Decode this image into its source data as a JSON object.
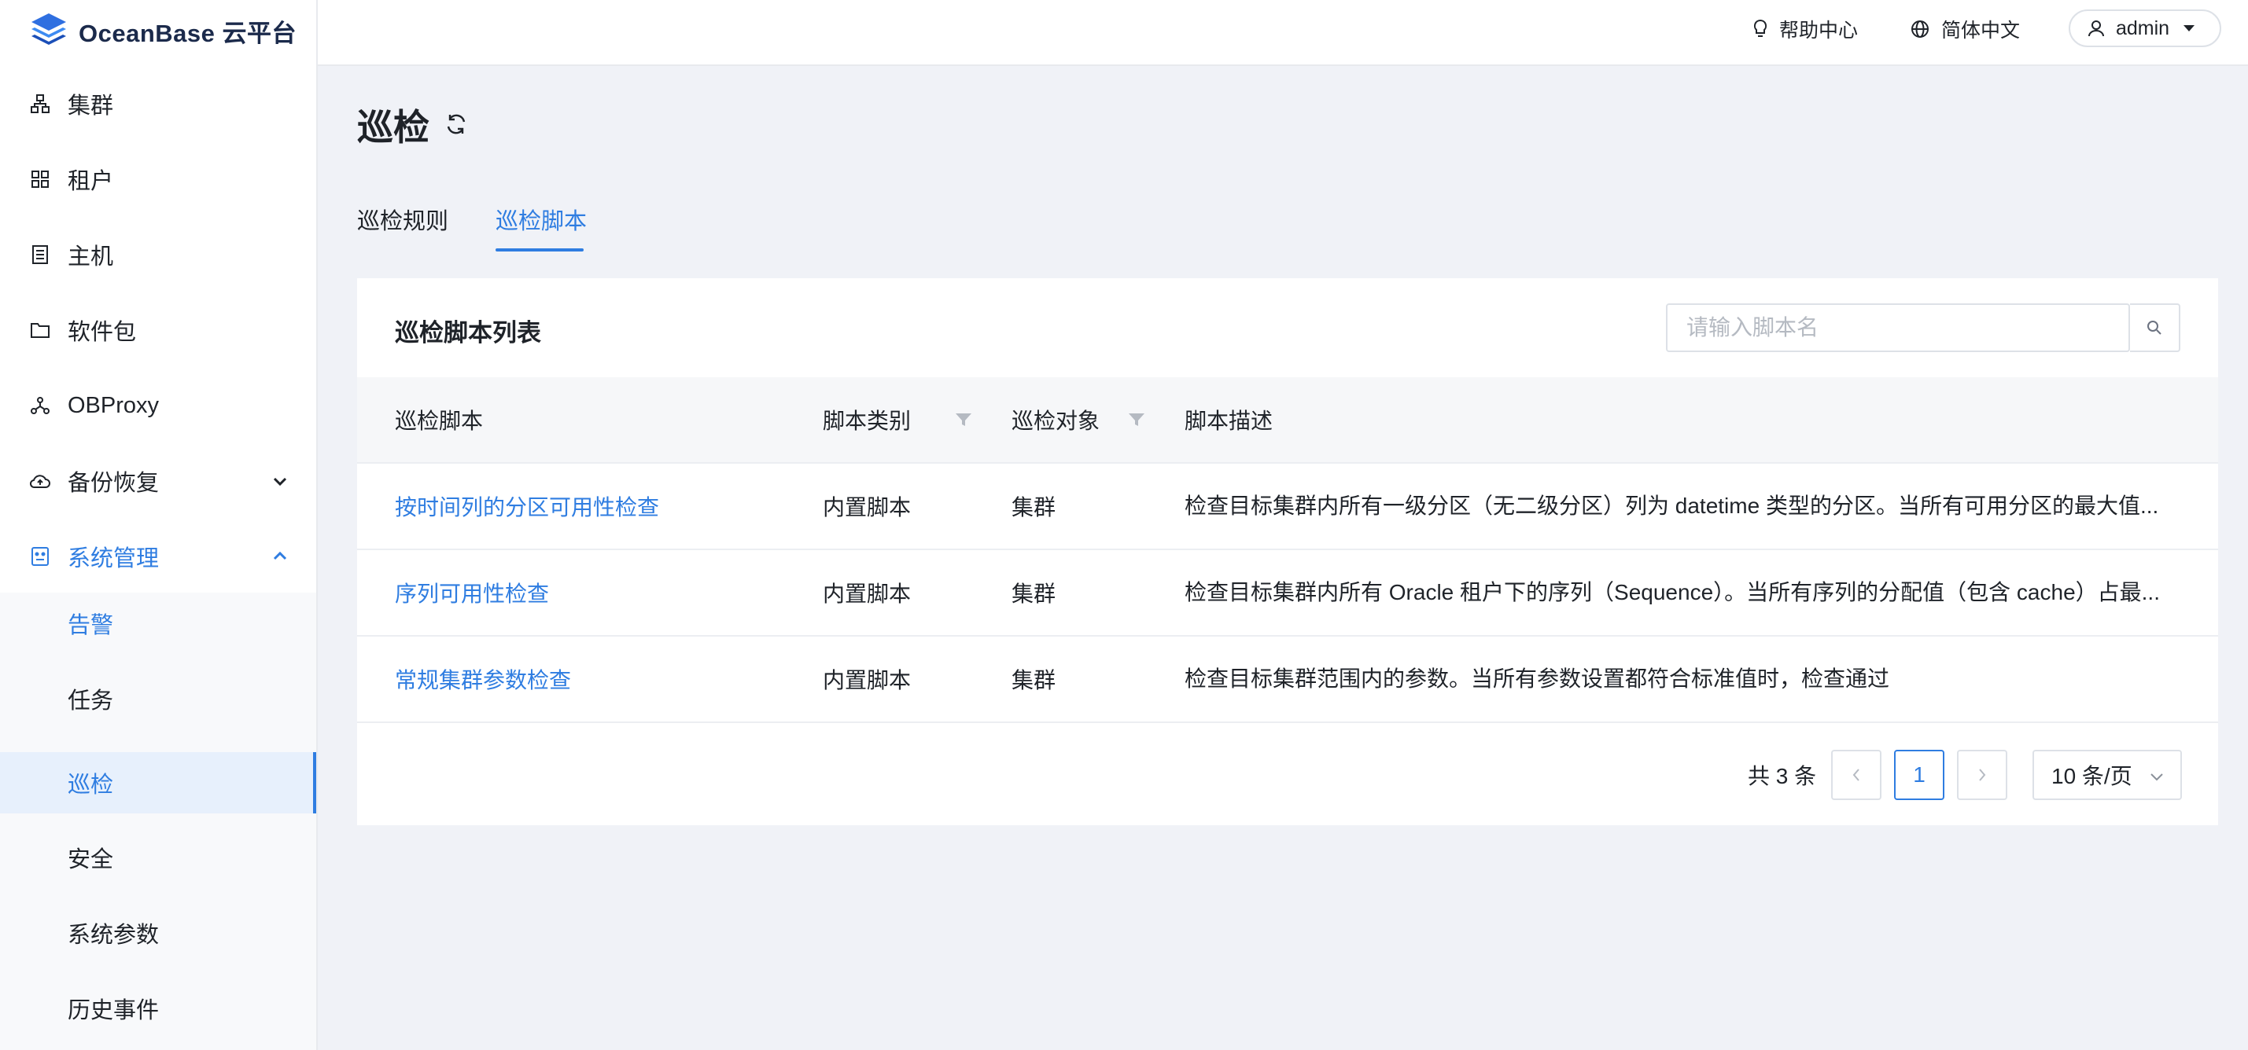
{
  "app": {
    "name": "OceanBase 云平台"
  },
  "header": {
    "help_label": "帮助中心",
    "lang_label": "简体中文",
    "user_label": "admin"
  },
  "sidebar": {
    "items": [
      {
        "label": "集群",
        "icon": "cluster-icon"
      },
      {
        "label": "租户",
        "icon": "tenant-grid-icon"
      },
      {
        "label": "主机",
        "icon": "host-icon"
      },
      {
        "label": "软件包",
        "icon": "folder-icon"
      },
      {
        "label": "OBProxy",
        "icon": "proxy-icon"
      },
      {
        "label": "备份恢复",
        "icon": "cloud-backup-icon"
      },
      {
        "label": "系统管理",
        "icon": "system-icon"
      }
    ],
    "sub_items": [
      {
        "label": "告警"
      },
      {
        "label": "任务"
      },
      {
        "label": "巡检"
      },
      {
        "label": "安全"
      },
      {
        "label": "系统参数"
      },
      {
        "label": "历史事件"
      }
    ]
  },
  "page": {
    "title": "巡检",
    "tabs": [
      {
        "label": "巡检规则"
      },
      {
        "label": "巡检脚本"
      }
    ]
  },
  "card": {
    "title": "巡检脚本列表",
    "search_placeholder": "请输入脚本名"
  },
  "table": {
    "columns": [
      "巡检脚本",
      "脚本类别",
      "巡检对象",
      "脚本描述"
    ],
    "rows": [
      {
        "name": "按时间列的分区可用性检查",
        "category": "内置脚本",
        "target": "集群",
        "description": "检查目标集群内所有一级分区（无二级分区）列为 datetime 类型的分区。当所有可用分区的最大值..."
      },
      {
        "name": "序列可用性检查",
        "category": "内置脚本",
        "target": "集群",
        "description": "检查目标集群内所有 Oracle 租户下的序列（Sequence）。当所有序列的分配值（包含 cache）占最..."
      },
      {
        "name": "常规集群参数检查",
        "category": "内置脚本",
        "target": "集群",
        "description": "检查目标集群范围内的参数。当所有参数设置都符合标准值时，检查通过"
      }
    ]
  },
  "pagination": {
    "total_label": "共 3 条",
    "current_page": "1",
    "page_size_label": "10 条/页"
  },
  "colors": {
    "primary": "#2f7de1",
    "background": "#f0f2f7"
  }
}
